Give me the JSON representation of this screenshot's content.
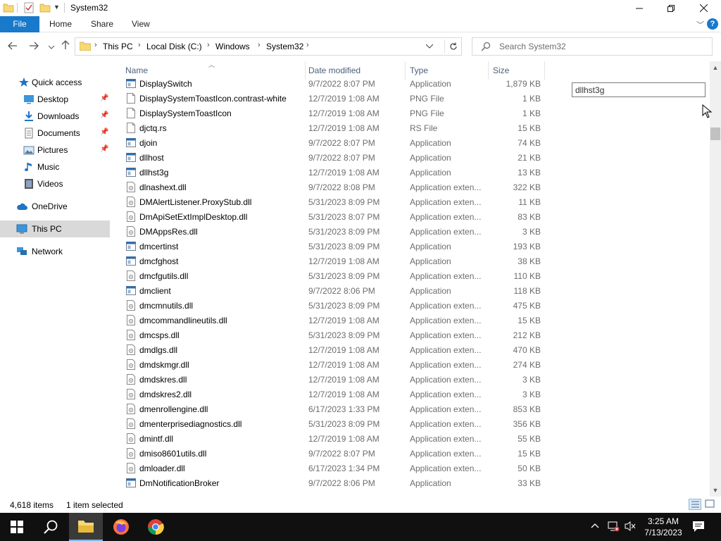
{
  "window": {
    "title": "System32"
  },
  "ribbon": {
    "tabs": [
      "File",
      "Home",
      "Share",
      "View"
    ],
    "help_label": "?"
  },
  "address": {
    "crumbs": [
      "This PC",
      "Local Disk (C:)",
      "Windows",
      "System32"
    ]
  },
  "search": {
    "placeholder": "Search System32"
  },
  "nav": {
    "items": [
      {
        "label": "Quick access",
        "icon": "star-icon"
      },
      {
        "label": "Desktop",
        "icon": "desktop-icon",
        "pinned": true
      },
      {
        "label": "Downloads",
        "icon": "download-icon",
        "pinned": true
      },
      {
        "label": "Documents",
        "icon": "documents-icon",
        "pinned": true
      },
      {
        "label": "Pictures",
        "icon": "pictures-icon",
        "pinned": true
      },
      {
        "label": "Music",
        "icon": "music-icon"
      },
      {
        "label": "Videos",
        "icon": "videos-icon"
      },
      {
        "label": "OneDrive",
        "icon": "cloud-icon"
      },
      {
        "label": "This PC",
        "icon": "computer-icon",
        "selected": true
      },
      {
        "label": "Network",
        "icon": "network-icon"
      }
    ]
  },
  "columns": {
    "name": "Name",
    "date": "Date modified",
    "type": "Type",
    "size": "Size"
  },
  "files": [
    {
      "name": "DisplaySwitch",
      "date": "9/7/2022 8:07 PM",
      "type": "Application",
      "size": "1,879 KB",
      "kind": "app"
    },
    {
      "name": "DisplaySystemToastIcon.contrast-white",
      "date": "12/7/2019 1:08 AM",
      "type": "PNG File",
      "size": "1 KB",
      "kind": "blank"
    },
    {
      "name": "DisplaySystemToastIcon",
      "date": "12/7/2019 1:08 AM",
      "type": "PNG File",
      "size": "1 KB",
      "kind": "blank"
    },
    {
      "name": "djctq.rs",
      "date": "12/7/2019 1:08 AM",
      "type": "RS File",
      "size": "15 KB",
      "kind": "blank"
    },
    {
      "name": "djoin",
      "date": "9/7/2022 8:07 PM",
      "type": "Application",
      "size": "74 KB",
      "kind": "app"
    },
    {
      "name": "dllhost",
      "date": "9/7/2022 8:07 PM",
      "type": "Application",
      "size": "21 KB",
      "kind": "app"
    },
    {
      "name": "dllhst3g",
      "date": "12/7/2019 1:08 AM",
      "type": "Application",
      "size": "13 KB",
      "kind": "app"
    },
    {
      "name": "dlnashext.dll",
      "date": "9/7/2022 8:08 PM",
      "type": "Application exten...",
      "size": "322 KB",
      "kind": "dll"
    },
    {
      "name": "DMAlertListener.ProxyStub.dll",
      "date": "5/31/2023 8:09 PM",
      "type": "Application exten...",
      "size": "11 KB",
      "kind": "dll"
    },
    {
      "name": "DmApiSetExtImplDesktop.dll",
      "date": "5/31/2023 8:07 PM",
      "type": "Application exten...",
      "size": "83 KB",
      "kind": "dll"
    },
    {
      "name": "DMAppsRes.dll",
      "date": "5/31/2023 8:09 PM",
      "type": "Application exten...",
      "size": "3 KB",
      "kind": "dll"
    },
    {
      "name": "dmcertinst",
      "date": "5/31/2023 8:09 PM",
      "type": "Application",
      "size": "193 KB",
      "kind": "app"
    },
    {
      "name": "dmcfghost",
      "date": "12/7/2019 1:08 AM",
      "type": "Application",
      "size": "38 KB",
      "kind": "app"
    },
    {
      "name": "dmcfgutils.dll",
      "date": "5/31/2023 8:09 PM",
      "type": "Application exten...",
      "size": "110 KB",
      "kind": "dll"
    },
    {
      "name": "dmclient",
      "date": "9/7/2022 8:06 PM",
      "type": "Application",
      "size": "118 KB",
      "kind": "app"
    },
    {
      "name": "dmcmnutils.dll",
      "date": "5/31/2023 8:09 PM",
      "type": "Application exten...",
      "size": "475 KB",
      "kind": "dll"
    },
    {
      "name": "dmcommandlineutils.dll",
      "date": "12/7/2019 1:08 AM",
      "type": "Application exten...",
      "size": "15 KB",
      "kind": "dll"
    },
    {
      "name": "dmcsps.dll",
      "date": "5/31/2023 8:09 PM",
      "type": "Application exten...",
      "size": "212 KB",
      "kind": "dll"
    },
    {
      "name": "dmdlgs.dll",
      "date": "12/7/2019 1:08 AM",
      "type": "Application exten...",
      "size": "470 KB",
      "kind": "dll"
    },
    {
      "name": "dmdskmgr.dll",
      "date": "12/7/2019 1:08 AM",
      "type": "Application exten...",
      "size": "274 KB",
      "kind": "dll"
    },
    {
      "name": "dmdskres.dll",
      "date": "12/7/2019 1:08 AM",
      "type": "Application exten...",
      "size": "3 KB",
      "kind": "dll"
    },
    {
      "name": "dmdskres2.dll",
      "date": "12/7/2019 1:08 AM",
      "type": "Application exten...",
      "size": "3 KB",
      "kind": "dll"
    },
    {
      "name": "dmenrollengine.dll",
      "date": "6/17/2023 1:33 PM",
      "type": "Application exten...",
      "size": "853 KB",
      "kind": "dll"
    },
    {
      "name": "dmenterprisediagnostics.dll",
      "date": "5/31/2023 8:09 PM",
      "type": "Application exten...",
      "size": "356 KB",
      "kind": "dll"
    },
    {
      "name": "dmintf.dll",
      "date": "12/7/2019 1:08 AM",
      "type": "Application exten...",
      "size": "55 KB",
      "kind": "dll"
    },
    {
      "name": "dmiso8601utils.dll",
      "date": "9/7/2022 8:07 PM",
      "type": "Application exten...",
      "size": "15 KB",
      "kind": "dll"
    },
    {
      "name": "dmloader.dll",
      "date": "6/17/2023 1:34 PM",
      "type": "Application exten...",
      "size": "50 KB",
      "kind": "dll"
    },
    {
      "name": "DmNotificationBroker",
      "date": "9/7/2022 8:06 PM",
      "type": "Application",
      "size": "33 KB",
      "kind": "app"
    }
  ],
  "floating_textbox": {
    "value": "dllhst3g"
  },
  "status": {
    "count": "4,618 items",
    "selected": "1 item selected"
  },
  "clock": {
    "time": "3:25 AM",
    "date": "7/13/2023"
  },
  "colors": {
    "accent": "#1979ca",
    "selection": "#d9d9d9",
    "taskbar": "#101010"
  }
}
